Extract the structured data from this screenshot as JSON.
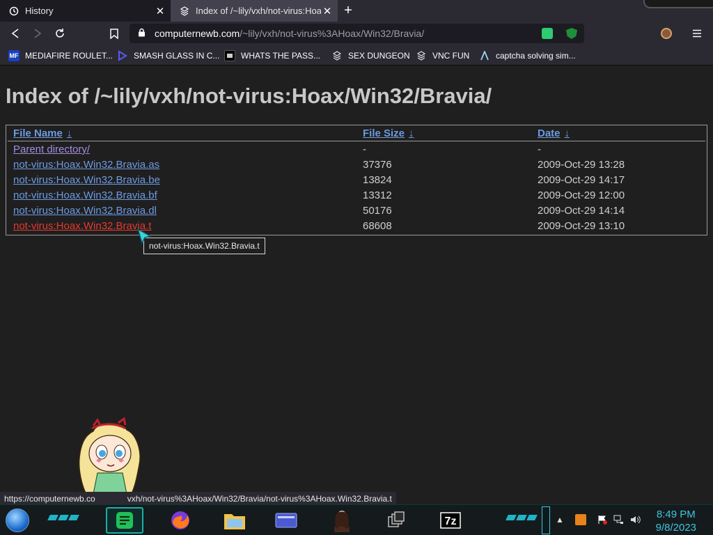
{
  "tabs": [
    {
      "label": "History",
      "icon": "history-icon"
    },
    {
      "label": "Index of /~lily/vxh/not-virus:Hoax/",
      "icon": "page-icon"
    }
  ],
  "nav": {
    "url_host": "computernewb.com",
    "url_path": "/~lily/vxh/not-virus%3AHoax/Win32/Bravia/"
  },
  "bookmarks": [
    {
      "label": "MEDIAFIRE ROULET...",
      "icon_text": "MF"
    },
    {
      "label": "SMASH GLASS IN C...",
      "icon_text": ""
    },
    {
      "label": "WHATS THE PASS...",
      "icon_text": ""
    },
    {
      "label": "SEX DUNGEON",
      "icon_text": ""
    },
    {
      "label": "VNC FUN",
      "icon_text": ""
    },
    {
      "label": "captcha solving sim...",
      "icon_text": ""
    }
  ],
  "page": {
    "title": "Index of /~lily/vxh/not-virus:Hoax/Win32/Bravia/",
    "headers": {
      "name": "File Name",
      "size": "File Size",
      "date": "Date",
      "sort_arrow": "↓"
    },
    "rows": [
      {
        "name": "Parent directory/",
        "size": "-",
        "date": "-"
      },
      {
        "name": "not-virus:Hoax.Win32.Bravia.as",
        "size": "37376",
        "date": "2009-Oct-29 13:28"
      },
      {
        "name": "not-virus:Hoax.Win32.Bravia.be",
        "size": "13824",
        "date": "2009-Oct-29 14:17"
      },
      {
        "name": "not-virus:Hoax.Win32.Bravia.bf",
        "size": "13312",
        "date": "2009-Oct-29 12:00"
      },
      {
        "name": "not-virus:Hoax.Win32.Bravia.dl",
        "size": "50176",
        "date": "2009-Oct-29 14:14"
      },
      {
        "name": "not-virus:Hoax.Win32.Bravia.t",
        "size": "68608",
        "date": "2009-Oct-29 13:10"
      }
    ],
    "tooltip": "not-virus:Hoax.Win32.Bravia.t",
    "status_url": "https://computernewb.co",
    "status_url_tail": "vxh/not-virus%3AHoax/Win32/Bravia/not-virus%3AHoax.Win32.Bravia.t"
  },
  "taskbar": {
    "time": "8:49 PM",
    "date": "9/8/2023"
  },
  "colors": {
    "link": "#6d9ae0",
    "visited": "#a48de0",
    "hover": "#e8382f",
    "accent": "#3ec6e0"
  }
}
